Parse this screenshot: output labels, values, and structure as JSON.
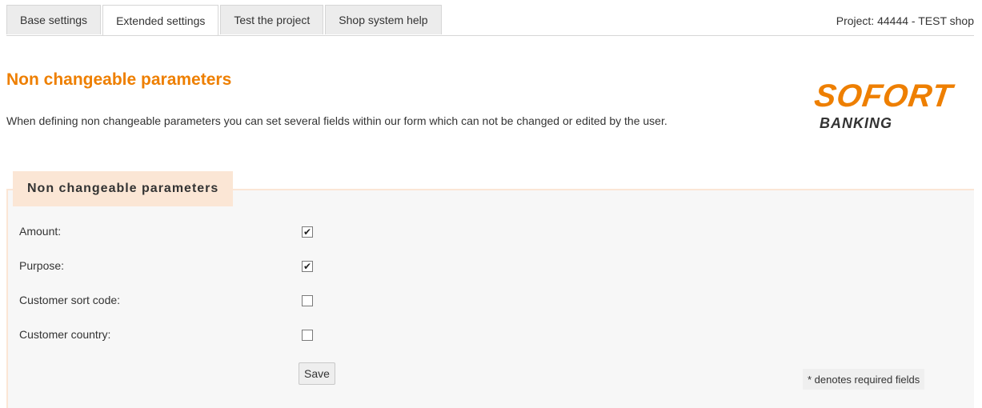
{
  "tabs": [
    {
      "label": "Base settings"
    },
    {
      "label": "Extended settings"
    },
    {
      "label": "Test the project"
    },
    {
      "label": "Shop system help"
    }
  ],
  "active_tab": "Extended settings",
  "project": {
    "label": "Project:",
    "value": "44444 - TEST shop"
  },
  "heading": "Non changeable parameters",
  "intro": "When defining non changeable parameters you can set several fields within our form which can not be changed or edited by the user.",
  "logo": {
    "main": "SOFORT",
    "sub": "BANKING"
  },
  "form": {
    "legend": "Non changeable parameters",
    "fields": [
      {
        "label": "Amount:",
        "checked": true
      },
      {
        "label": "Purpose:",
        "checked": true
      },
      {
        "label": "Customer sort code:",
        "checked": false
      },
      {
        "label": "Customer country:",
        "checked": false
      }
    ],
    "save_label": "Save",
    "required_note": "* denotes required fields"
  },
  "colors": {
    "accent": "#ee7f00",
    "legend_bg": "#fbe6d5",
    "panel_bg": "#f7f7f7"
  }
}
